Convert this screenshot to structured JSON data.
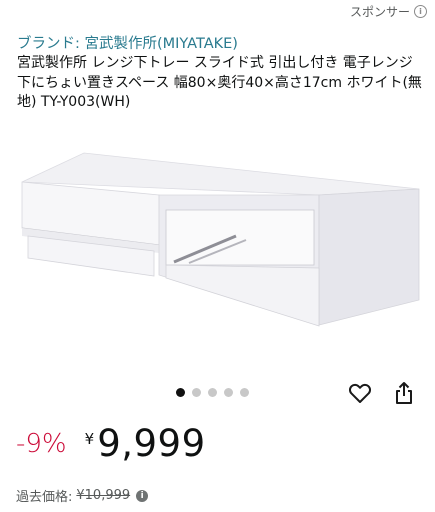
{
  "header": {
    "sponsored_label": "スポンサー",
    "info_icon": "info-icon"
  },
  "product": {
    "brand_link": "ブランド: 宮武製作所(MIYATAKE)",
    "title": "宮武製作所 レンジ下トレー スライド式 引出し付き 電子レンジ下にちょい置きスペース 幅80×奥行40×高さ17cm ホワイト(無地) TY-Y003(WH)"
  },
  "carousel": {
    "total": 5,
    "active_index": 0
  },
  "actions": {
    "wishlist_icon": "heart-icon",
    "share_icon": "share-icon"
  },
  "price": {
    "discount": "-9%",
    "currency": "¥",
    "amount": "9,999"
  },
  "past_price": {
    "label": "過去価格:",
    "value": "¥10,999"
  },
  "colors": {
    "link": "#2a7b8f",
    "discount": "#cc0c39",
    "text": "#0f1111",
    "muted": "#565959"
  }
}
